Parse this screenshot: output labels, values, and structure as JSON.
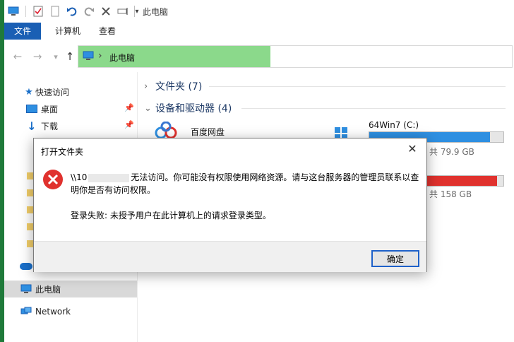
{
  "window": {
    "title": "此电脑"
  },
  "ribbon": {
    "tabs": [
      "文件",
      "计算机",
      "查看"
    ]
  },
  "address": {
    "path": "此电脑"
  },
  "nav": {
    "items": [
      {
        "label": "快速访问",
        "icon": "star-icon"
      },
      {
        "label": "桌面",
        "icon": "desktop-icon"
      },
      {
        "label": "下载",
        "icon": "download-icon"
      },
      {
        "label": "此电脑",
        "icon": "computer-icon"
      },
      {
        "label": "Network",
        "icon": "network-icon"
      }
    ]
  },
  "content": {
    "groups": {
      "folders": "文件夹 (7)",
      "drives": "设备和驱动器 (4)"
    },
    "drives": [
      {
        "name": "百度网盘",
        "icon": "baidu-netdisk-icon"
      },
      {
        "name": "64Win7  (C:)",
        "free": "共 79.9 GB",
        "used_fraction": 0.9,
        "bar_color": "#2e8fe1"
      },
      {
        "name": "",
        "free": "共 158 GB",
        "used_fraction": 0.95,
        "bar_color": "#e0322e"
      }
    ]
  },
  "dialog": {
    "title": "打开文件夹",
    "message_prefix": "\\\\10",
    "message": "无法访问。你可能没有权限使用网络资源。请与这台服务器的管理员联系以查明你是否有访问权限。",
    "detail": "登录失败: 未授予用户在此计算机上的请求登录类型。",
    "ok": "确定"
  },
  "colors": {
    "accent": "#1a5fb4",
    "address_highlight": "#8bd98b",
    "error": "#e0322e"
  }
}
